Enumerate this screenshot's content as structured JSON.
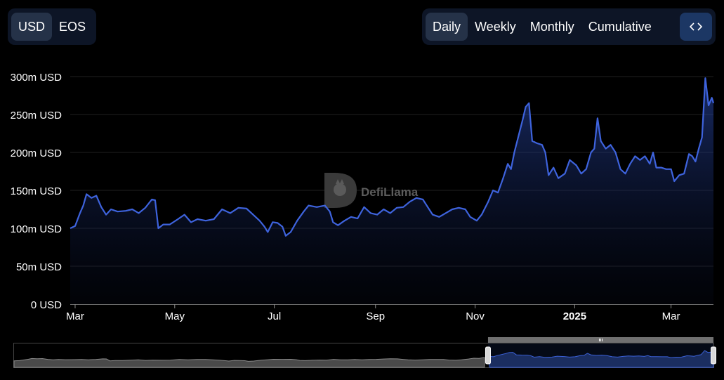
{
  "currency_toggle": {
    "options": [
      "USD",
      "EOS"
    ],
    "selected": "USD"
  },
  "period_toggle": {
    "options": [
      "Daily",
      "Weekly",
      "Monthly",
      "Cumulative"
    ],
    "selected": "Daily"
  },
  "embed_icon": "code-brackets-icon",
  "watermark": "DefiLlama",
  "colors": {
    "accent": "#4a6ee0",
    "line": "#3e63dd",
    "active_bg": "#253248",
    "panel_bg": "#0d1526"
  },
  "chart_data": {
    "type": "area",
    "title": "",
    "xlabel": "",
    "ylabel": "",
    "ylim": [
      0,
      300
    ],
    "y_ticks": [
      0,
      50,
      100,
      150,
      200,
      250,
      300
    ],
    "y_tick_labels": [
      "0 USD",
      "50m USD",
      "100m USD",
      "150m USD",
      "200m USD",
      "250m USD",
      "300m USD"
    ],
    "x_range": [
      "2024-02-27",
      "2025-03-27"
    ],
    "x_ticks": [
      {
        "date": "2024-03-01",
        "label": "Mar",
        "bold": false
      },
      {
        "date": "2024-05-01",
        "label": "May",
        "bold": false
      },
      {
        "date": "2024-07-01",
        "label": "Jul",
        "bold": false
      },
      {
        "date": "2024-09-01",
        "label": "Sep",
        "bold": false
      },
      {
        "date": "2024-11-01",
        "label": "Nov",
        "bold": false
      },
      {
        "date": "2025-01-01",
        "label": "2025",
        "bold": true
      },
      {
        "date": "2025-03-01",
        "label": "Mar",
        "bold": false
      }
    ],
    "series": [
      {
        "name": "",
        "unit": "million USD",
        "points": [
          [
            "2024-02-27",
            100
          ],
          [
            "2024-03-01",
            103
          ],
          [
            "2024-03-04",
            120
          ],
          [
            "2024-03-06",
            130
          ],
          [
            "2024-03-08",
            145
          ],
          [
            "2024-03-11",
            140
          ],
          [
            "2024-03-14",
            143
          ],
          [
            "2024-03-17",
            128
          ],
          [
            "2024-03-20",
            118
          ],
          [
            "2024-03-23",
            125
          ],
          [
            "2024-03-27",
            122
          ],
          [
            "2024-04-01",
            123
          ],
          [
            "2024-04-05",
            125
          ],
          [
            "2024-04-09",
            120
          ],
          [
            "2024-04-13",
            127
          ],
          [
            "2024-04-17",
            138
          ],
          [
            "2024-04-19",
            137
          ],
          [
            "2024-04-21",
            100
          ],
          [
            "2024-04-24",
            105
          ],
          [
            "2024-04-28",
            105
          ],
          [
            "2024-05-03",
            112
          ],
          [
            "2024-05-07",
            118
          ],
          [
            "2024-05-11",
            108
          ],
          [
            "2024-05-15",
            112
          ],
          [
            "2024-05-20",
            110
          ],
          [
            "2024-05-25",
            112
          ],
          [
            "2024-05-30",
            125
          ],
          [
            "2024-06-04",
            120
          ],
          [
            "2024-06-09",
            127
          ],
          [
            "2024-06-14",
            126
          ],
          [
            "2024-06-18",
            118
          ],
          [
            "2024-06-22",
            110
          ],
          [
            "2024-06-25",
            102
          ],
          [
            "2024-06-27",
            95
          ],
          [
            "2024-06-30",
            108
          ],
          [
            "2024-07-03",
            107
          ],
          [
            "2024-07-06",
            102
          ],
          [
            "2024-07-08",
            90
          ],
          [
            "2024-07-11",
            95
          ],
          [
            "2024-07-15",
            110
          ],
          [
            "2024-07-19",
            122
          ],
          [
            "2024-07-22",
            130
          ],
          [
            "2024-07-27",
            128
          ],
          [
            "2024-08-01",
            130
          ],
          [
            "2024-08-04",
            122
          ],
          [
            "2024-08-06",
            108
          ],
          [
            "2024-08-09",
            104
          ],
          [
            "2024-08-13",
            110
          ],
          [
            "2024-08-17",
            115
          ],
          [
            "2024-08-21",
            113
          ],
          [
            "2024-08-25",
            128
          ],
          [
            "2024-08-29",
            120
          ],
          [
            "2024-09-02",
            118
          ],
          [
            "2024-09-06",
            125
          ],
          [
            "2024-09-10",
            120
          ],
          [
            "2024-09-14",
            127
          ],
          [
            "2024-09-18",
            128
          ],
          [
            "2024-09-22",
            135
          ],
          [
            "2024-09-26",
            140
          ],
          [
            "2024-09-30",
            138
          ],
          [
            "2024-10-03",
            128
          ],
          [
            "2024-10-06",
            118
          ],
          [
            "2024-10-10",
            115
          ],
          [
            "2024-10-14",
            120
          ],
          [
            "2024-10-18",
            125
          ],
          [
            "2024-10-22",
            127
          ],
          [
            "2024-10-26",
            125
          ],
          [
            "2024-10-29",
            115
          ],
          [
            "2024-11-02",
            110
          ],
          [
            "2024-11-05",
            118
          ],
          [
            "2024-11-09",
            135
          ],
          [
            "2024-11-12",
            150
          ],
          [
            "2024-11-15",
            147
          ],
          [
            "2024-11-18",
            165
          ],
          [
            "2024-11-21",
            185
          ],
          [
            "2024-11-23",
            178
          ],
          [
            "2024-11-25",
            200
          ],
          [
            "2024-11-28",
            225
          ],
          [
            "2024-11-30",
            242
          ],
          [
            "2024-12-02",
            260
          ],
          [
            "2024-12-04",
            265
          ],
          [
            "2024-12-06",
            215
          ],
          [
            "2024-12-09",
            212
          ],
          [
            "2024-12-12",
            210
          ],
          [
            "2024-12-14",
            200
          ],
          [
            "2024-12-16",
            170
          ],
          [
            "2024-12-19",
            180
          ],
          [
            "2024-12-22",
            166
          ],
          [
            "2024-12-26",
            172
          ],
          [
            "2024-12-29",
            190
          ],
          [
            "2025-01-02",
            183
          ],
          [
            "2025-01-05",
            172
          ],
          [
            "2025-01-08",
            178
          ],
          [
            "2025-01-11",
            200
          ],
          [
            "2025-01-13",
            205
          ],
          [
            "2025-01-15",
            245
          ],
          [
            "2025-01-17",
            215
          ],
          [
            "2025-01-20",
            205
          ],
          [
            "2025-01-23",
            210
          ],
          [
            "2025-01-26",
            200
          ],
          [
            "2025-01-29",
            178
          ],
          [
            "2025-02-01",
            172
          ],
          [
            "2025-02-04",
            185
          ],
          [
            "2025-02-07",
            195
          ],
          [
            "2025-02-10",
            190
          ],
          [
            "2025-02-13",
            195
          ],
          [
            "2025-02-16",
            185
          ],
          [
            "2025-02-18",
            200
          ],
          [
            "2025-02-20",
            180
          ],
          [
            "2025-02-23",
            180
          ],
          [
            "2025-02-26",
            178
          ],
          [
            "2025-03-01",
            178
          ],
          [
            "2025-03-03",
            162
          ],
          [
            "2025-03-06",
            170
          ],
          [
            "2025-03-09",
            172
          ],
          [
            "2025-03-12",
            198
          ],
          [
            "2025-03-14",
            195
          ],
          [
            "2025-03-16",
            188
          ],
          [
            "2025-03-18",
            205
          ],
          [
            "2025-03-20",
            220
          ],
          [
            "2025-03-22",
            298
          ],
          [
            "2025-03-24",
            262
          ],
          [
            "2025-03-26",
            272
          ],
          [
            "2025-03-27",
            265
          ]
        ]
      }
    ],
    "grid": true,
    "legend": "none"
  },
  "range_selector": {
    "start": "2024-11-20",
    "end": "2025-03-27"
  }
}
